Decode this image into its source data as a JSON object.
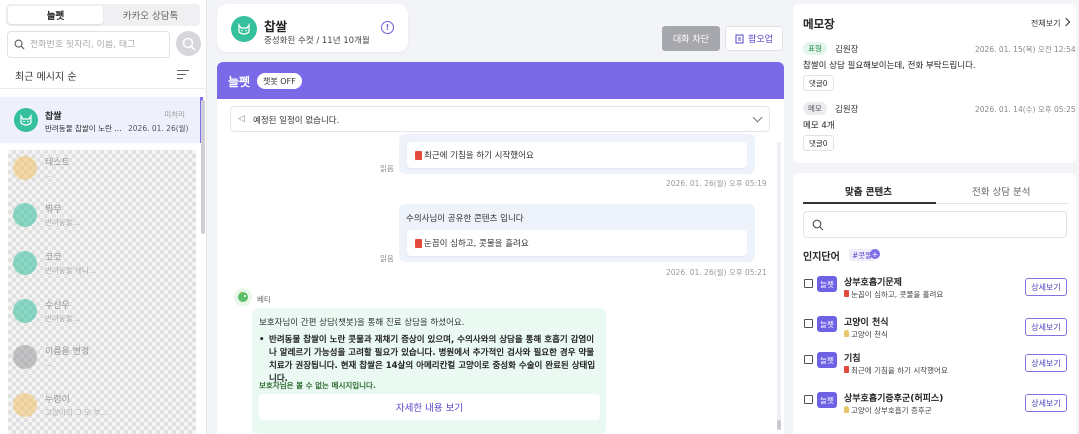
{
  "left": {
    "tabs": [
      "늘펫",
      "카카오 상담톡"
    ],
    "search_placeholder": "전화번호 뒷자리, 이름, 태그",
    "sort_label": "최근 메시지 순",
    "active_conversation": {
      "name": "찹쌀",
      "status": "미처리",
      "preview": "반려동물 찹쌀이 노란 콧...",
      "date": "2026. 01. 26(월)"
    },
    "blurred_items": [
      {
        "name": "테스트",
        "preview": "...",
        "color": "#f3c46b"
      },
      {
        "name": "뭐무",
        "preview": "반려동물...",
        "color": "#35c09e"
      },
      {
        "name": "코코",
        "preview": "반려동물 캐니...",
        "color": "#35c09e"
      },
      {
        "name": "수선우",
        "preview": "반려동물...",
        "color": "#35c09e"
      },
      {
        "name": "이름을 변경",
        "preview": "...",
        "color": "#9a9aa0"
      },
      {
        "name": "누렁이",
        "preview": "고양이의 그 모 부...",
        "color": "#f3c46b"
      }
    ]
  },
  "header": {
    "pet_name": "찹쌀",
    "pet_info": "중성화된 수컷 /  11년 10개월",
    "info_symbol": "!",
    "block_label": "대화 차단",
    "popup_label": "팝오업"
  },
  "chat": {
    "title": "늘펫",
    "chatbot_pill": "챗봇 OFF",
    "schedule_text": "예정된 일정이 없습니다.",
    "msg1": {
      "card": "최근에 기침을 하기 시작했어요",
      "read": "읽음",
      "timestamp": "2026. 01. 26(월) 오후 05:19"
    },
    "msg2": {
      "title": "수의사님이 공유한 콘텐츠 입니다",
      "card": "눈꼽이 심하고, 콧물을 흘려요",
      "read": "읽음",
      "timestamp": "2026. 01. 26(월) 오후 05:21"
    },
    "bot": {
      "name": "베티",
      "intro": "보호자님이 간편 상담(챗봇)을 통해 진료 상담을 하셨어요.",
      "bullet": "반려동물 찹쌀이 노란 콧물과 재채기 증상이 있으며, 수의사와의 상담을 통해 호흡기 감염이나 알레르기 가능성을 고려할 필요가 있습니다. 병원에서 추가적인 검사와 필요한 경우 약물 치료가 권장됩니다. 현재 찹쌀은 14살의 아메리칸컬 고양이로 중성화 수술이 완료된 상태입니다.",
      "note": "보호자님은 볼 수 없는 메시지입니다.",
      "detail_button": "자세한 내용 보기"
    }
  },
  "memo": {
    "title": "메모장",
    "view_all": "전체보기",
    "items": [
      {
        "tag": "표형",
        "author": "김원장",
        "date": "2026. 01. 15(목) 오전 12:54",
        "body": "찹쌀이 상담 필요해보이는데, 전화 부탁드립니다.",
        "reply": "댓글0",
        "tag_bg": "#e4f5ec",
        "tag_color": "#1f8a4c"
      },
      {
        "tag": "메모",
        "author": "김원장",
        "date": "2026. 01. 14(수) 오후 05:25",
        "body": "메모 4개",
        "reply": "댓글0",
        "tag_bg": "#ececf0",
        "tag_color": "#555555"
      }
    ]
  },
  "content": {
    "tabs": [
      "맞춤 콘텐츠",
      "전화 상담 분석"
    ],
    "search_placeholder": "",
    "keyword_title": "인지단어",
    "keyword_chip": "#콧물",
    "keyword_plus": "+",
    "rows": [
      {
        "badge": "늘펫",
        "title": "상부호흡기문제",
        "sub": "눈꼽이 심하고, 콧물을 흘려요",
        "icon": "red",
        "button": "상세보기"
      },
      {
        "badge": "늘펫",
        "title": "고양이 천식",
        "sub": "고양이 천식",
        "icon": "bulb",
        "button": "상세보기"
      },
      {
        "badge": "늘펫",
        "title": "기침",
        "sub": "최근에 기침을 하기 시작했어요",
        "icon": "red",
        "button": "상세보기"
      },
      {
        "badge": "늘펫",
        "title": "상부호흡기증후군(허피스)",
        "sub": "고양이 상부호흡기 증후군",
        "icon": "bulb",
        "button": "상세보기"
      }
    ]
  },
  "colors": {
    "accent": "#7a6ae8",
    "avatar_green": "#35c09e"
  }
}
